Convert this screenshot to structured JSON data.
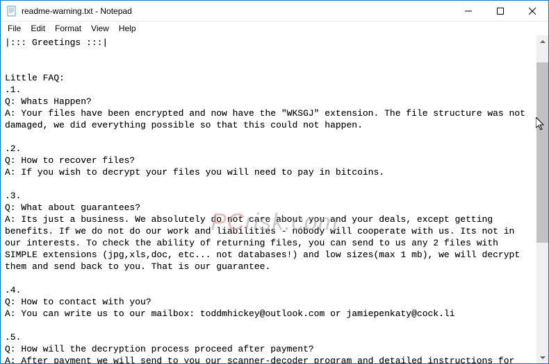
{
  "titlebar": {
    "title": "readme-warning.txt - Notepad"
  },
  "menubar": {
    "file": "File",
    "edit": "Edit",
    "format": "Format",
    "view": "View",
    "help": "Help"
  },
  "body": {
    "text": "|::: Greetings :::|\n\n\nLittle FAQ:\n.1.\nQ: Whats Happen?\nA: Your files have been encrypted and now have the \"WKSGJ\" extension. The file structure was not damaged, we did everything possible so that this could not happen.\n\n.2.\nQ: How to recover files?\nA: If you wish to decrypt your files you will need to pay in bitcoins.\n\n.3.\nQ: What about guarantees?\nA: Its just a business. We absolutely do not care about you and your deals, except getting benefits. If we do not do our work and liabilities - nobody will cooperate with us. Its not in our interests. To check the ability of returning files, you can send to us any 2 files with SIMPLE extensions (jpg,xls,doc, etc... not databases!) and low sizes(max 1 mb), we will decrypt them and send back to you. That is our guarantee.\n\n.4.\nQ: How to contact with you?\nA: You can write us to our mailbox: toddmhickey@outlook.com or jamiepenkaty@cock.li\n\n.5.\nQ: How will the decryption process proceed after payment?\nA: After payment we will send to you our scanner-decoder program and detailed instructions for use. With this program you will be able to decrypt all your encrypted files."
  },
  "watermark": {
    "prefix": "PC",
    "suffix": "risk.com"
  }
}
